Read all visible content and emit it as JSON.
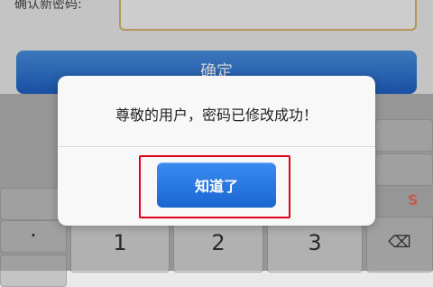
{
  "form": {
    "confirm_label": "确认新密码:",
    "confirm_button": "确定"
  },
  "keyboard": {
    "keys": [
      "1",
      "2",
      "3"
    ],
    "dot": "·",
    "backspace_icon": "backspace-icon"
  },
  "dialog": {
    "message": "尊敬的用户，密码已修改成功！",
    "ack_button": "知道了"
  },
  "colors": {
    "accent_blue": "#1f63c7",
    "highlight_red": "#e0001b"
  }
}
